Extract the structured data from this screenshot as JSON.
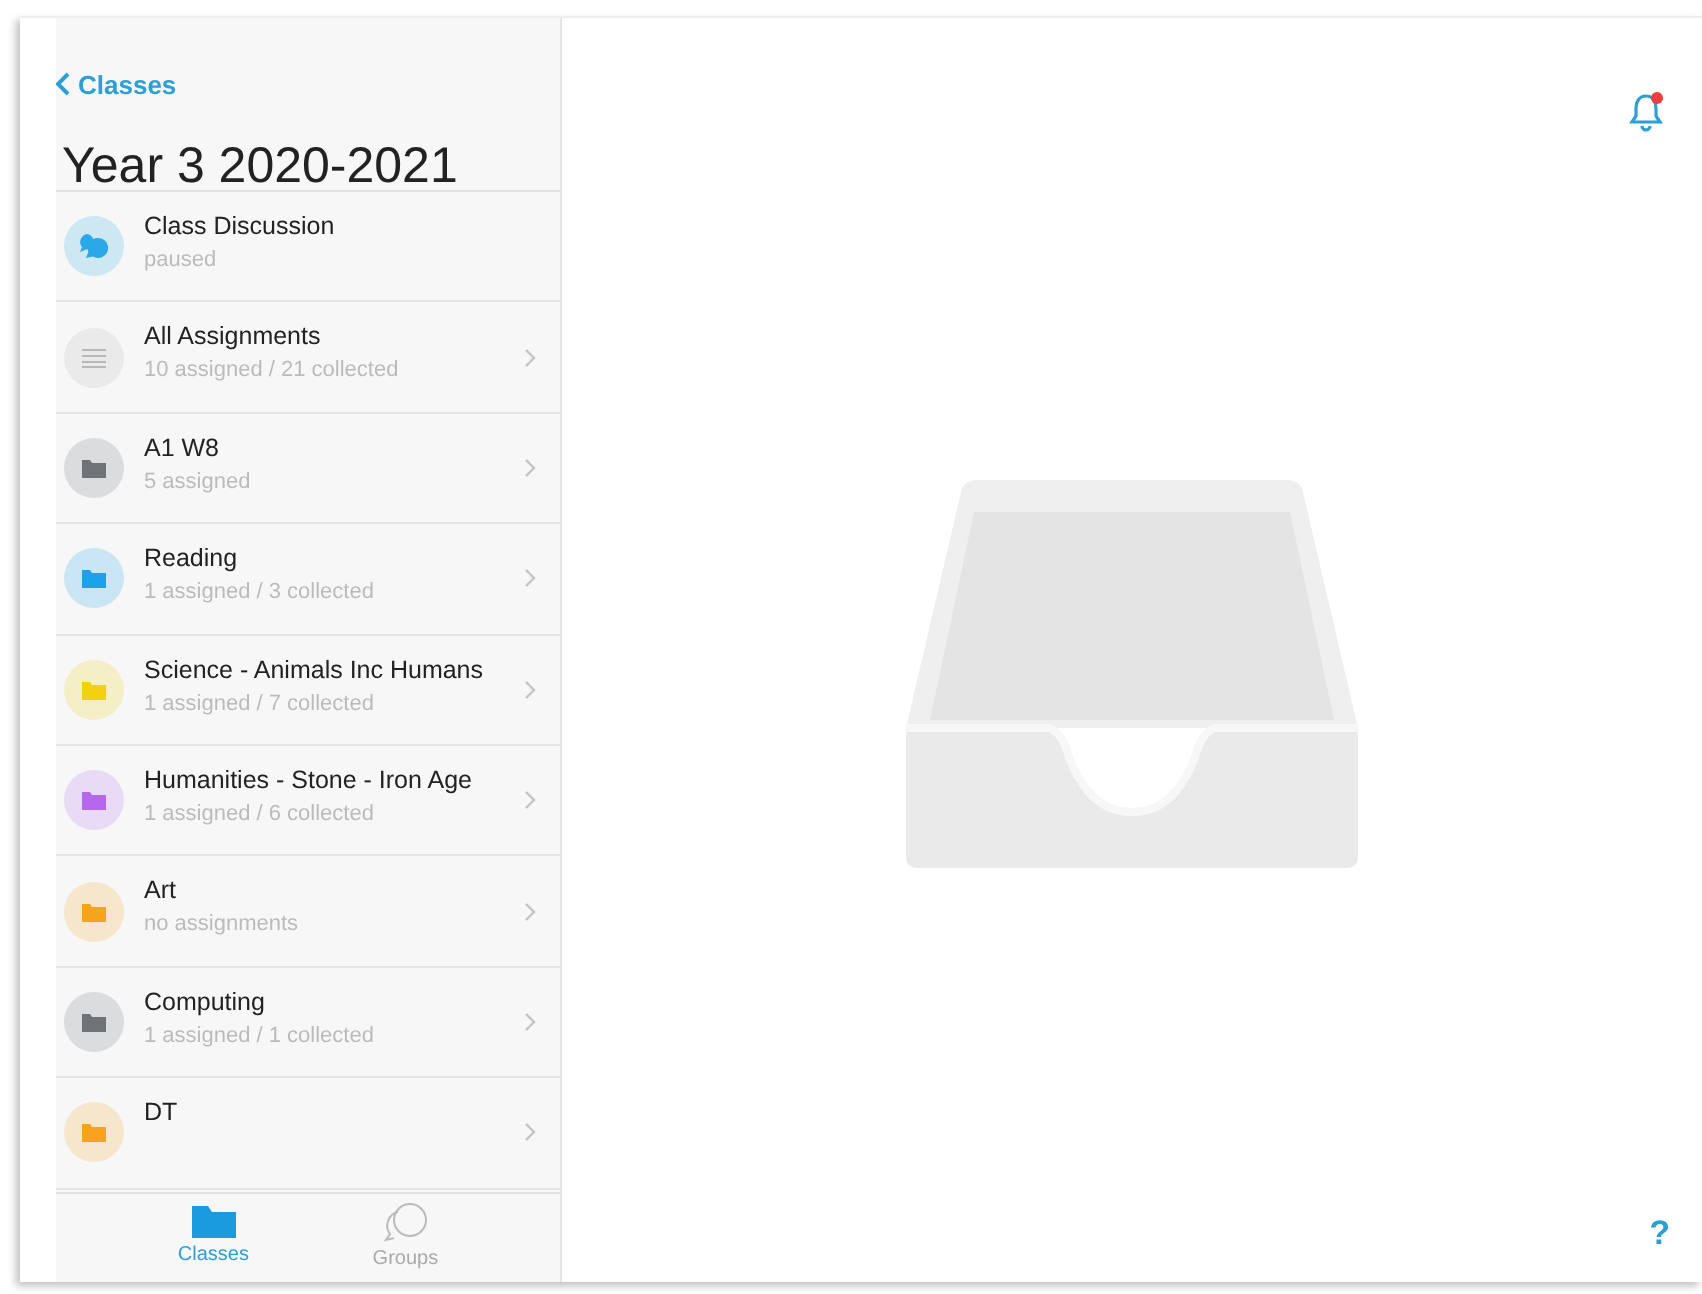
{
  "back_link": {
    "label": "Classes"
  },
  "title": "Year 3 2020-2021",
  "items": [
    {
      "kind": "discussion",
      "title": "Class Discussion",
      "subtitle": "paused",
      "color": "#2aa8e8",
      "chevron": false
    },
    {
      "kind": "all",
      "title": "All Assignments",
      "subtitle": "10 assigned / 21 collected",
      "color": "#b8b8b8",
      "chevron": true
    },
    {
      "kind": "folder",
      "title": "A1 W8",
      "subtitle": "5 assigned",
      "color": "#6e7378",
      "chevron": true
    },
    {
      "kind": "folder",
      "title": "Reading",
      "subtitle": "1 assigned / 3 collected",
      "color": "#1aa3ea",
      "chevron": true
    },
    {
      "kind": "folder",
      "title": "Science - Animals Inc Humans",
      "subtitle": "1 assigned / 7 collected",
      "color": "#f2d20e",
      "chevron": true
    },
    {
      "kind": "folder",
      "title": "Humanities - Stone - Iron Age",
      "subtitle": "1 assigned / 6 collected",
      "color": "#b667f0",
      "chevron": true
    },
    {
      "kind": "folder",
      "title": "Art",
      "subtitle": "no assignments",
      "color": "#f7a41c",
      "chevron": true
    },
    {
      "kind": "folder",
      "title": "Computing",
      "subtitle": "1 assigned / 1 collected",
      "color": "#6e7378",
      "chevron": true
    },
    {
      "kind": "folder",
      "title": "DT",
      "color": "#f7a41c",
      "chevron": true
    }
  ],
  "tab_bar": [
    {
      "kind": "folder",
      "label": "Classes",
      "selected": true
    },
    {
      "kind": "chat",
      "label": "Groups",
      "selected": false
    }
  ],
  "notifications": {
    "unread": true
  },
  "help": {
    "label": "?"
  }
}
